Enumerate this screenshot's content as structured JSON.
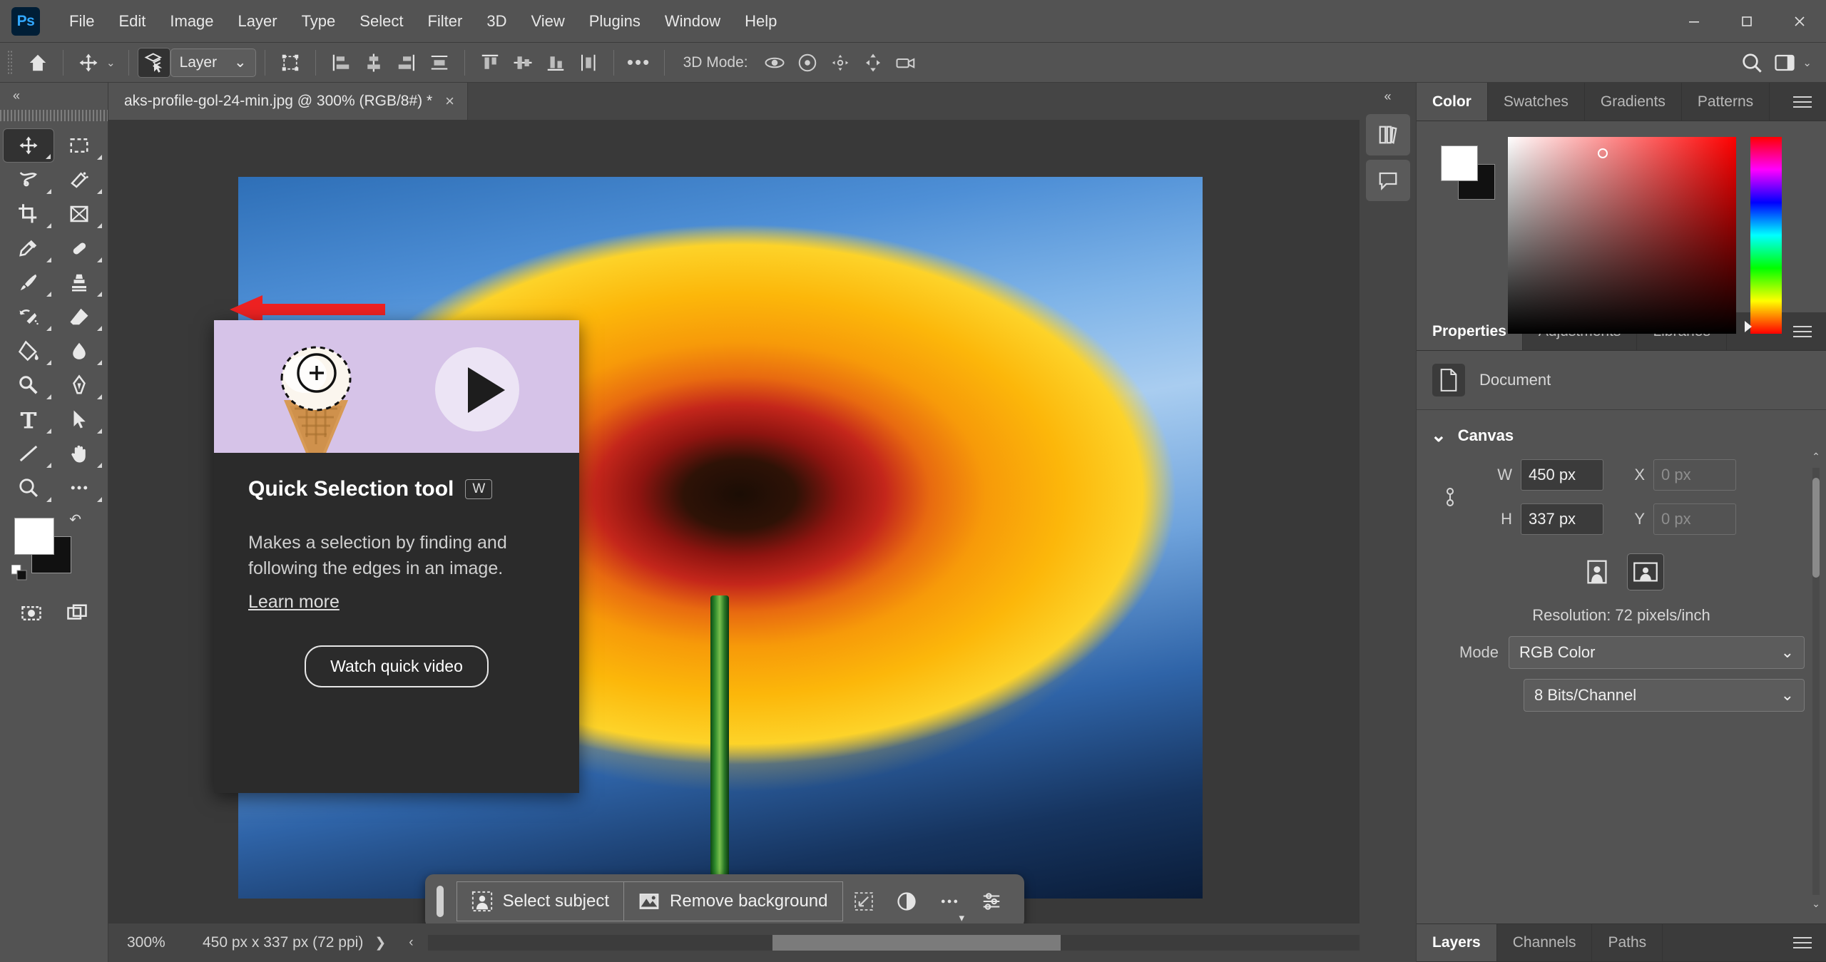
{
  "app": {
    "logo": "Ps",
    "accent": "#31a8ff",
    "chrome_bg": "#535353"
  },
  "menubar": {
    "items": [
      "File",
      "Edit",
      "Image",
      "Layer",
      "Type",
      "Select",
      "Filter",
      "3D",
      "View",
      "Plugins",
      "Window",
      "Help"
    ],
    "window_controls": {
      "minimize": "—",
      "maximize": "☐",
      "close": "✕"
    }
  },
  "optionsbar": {
    "home_icon": "home-icon",
    "move_tool_icon": "move-tool-icon",
    "auto_select_icon": "auto-select-layers-icon",
    "layer_select_value": "Layer",
    "transform_controls_icon": "show-transform-controls-icon",
    "align_icons": [
      "align-left-edges",
      "align-horizontal-centers",
      "align-right-edges",
      "distribute-horizontally"
    ],
    "distribute_icons": [
      "align-top-edges",
      "align-vertical-centers",
      "align-bottom-edges",
      "distribute-vertically"
    ],
    "more_label": "•••",
    "three_d_mode_label": "3D Mode:",
    "three_d_icons": [
      "orbit-3d-icon",
      "roll-3d-icon",
      "pan-3d-icon",
      "slide-3d-icon",
      "camera-3d-icon"
    ],
    "search_icon": "search-icon",
    "workspace_icon": "workspace-switcher-icon",
    "workspace_caret": "⌄"
  },
  "tools": {
    "collapse_label": "«",
    "items": [
      {
        "name": "move-tool",
        "glyph": "move",
        "active": true
      },
      {
        "name": "rectangular-marquee-tool",
        "glyph": "marquee",
        "active": false
      },
      {
        "name": "lasso-tool",
        "glyph": "lasso",
        "active": false
      },
      {
        "name": "quick-selection-tool",
        "glyph": "quickselect",
        "active": false
      },
      {
        "name": "crop-tool",
        "glyph": "crop",
        "active": false
      },
      {
        "name": "frame-tool",
        "glyph": "frame",
        "active": false
      },
      {
        "name": "eyedropper-tool",
        "glyph": "eyedropper",
        "active": false
      },
      {
        "name": "spot-healing-brush-tool",
        "glyph": "healing",
        "active": false
      },
      {
        "name": "brush-tool",
        "glyph": "brush",
        "active": false
      },
      {
        "name": "clone-stamp-tool",
        "glyph": "stamp",
        "active": false
      },
      {
        "name": "history-brush-tool",
        "glyph": "historybrush",
        "active": false
      },
      {
        "name": "eraser-tool",
        "glyph": "eraser",
        "active": false
      },
      {
        "name": "gradient-tool",
        "glyph": "bucket",
        "active": false
      },
      {
        "name": "blur-tool",
        "glyph": "blur",
        "active": false
      },
      {
        "name": "dodge-tool",
        "glyph": "dodge",
        "active": false
      },
      {
        "name": "pen-tool",
        "glyph": "pen",
        "active": false
      },
      {
        "name": "type-tool",
        "glyph": "type",
        "active": false
      },
      {
        "name": "path-selection-tool",
        "glyph": "pathselect",
        "active": false
      },
      {
        "name": "line-tool",
        "glyph": "line",
        "active": false
      },
      {
        "name": "hand-tool",
        "glyph": "hand",
        "active": false
      },
      {
        "name": "zoom-tool",
        "glyph": "zoom",
        "active": false
      },
      {
        "name": "edit-toolbar",
        "glyph": "ellipsis",
        "active": false
      }
    ],
    "foreground_color": "#ffffff",
    "background_color": "#111111",
    "quickmask_name": "quick-mask-icon",
    "screenmode_name": "screen-mode-icon"
  },
  "document": {
    "tab_title": "aks-profile-gol-24-min.jpg @ 300% (RGB/8#) *",
    "close_glyph": "×"
  },
  "tooltip": {
    "title": "Quick Selection tool",
    "shortcut": "W",
    "description": "Makes a selection by finding and following the edges in an image.",
    "link": "Learn more",
    "cta": "Watch quick video",
    "play_icon": "play-icon",
    "media_alt": "ice-cream-cone-selection-preview"
  },
  "annotation": {
    "arrow_color": "#ee2222",
    "arrow_name": "red-pointer-arrow"
  },
  "contextual_taskbar": {
    "grip_name": "drag-handle",
    "buttons": [
      {
        "label": "Select subject",
        "icon": "select-subject-icon"
      },
      {
        "label": "Remove background",
        "icon": "remove-background-icon"
      }
    ],
    "icon_buttons": [
      "transform-selection-icon",
      "adjustment-layer-icon",
      "more-options-icon",
      "taskbar-properties-icon"
    ],
    "caret": "▾"
  },
  "statusbar": {
    "zoom": "300%",
    "info": "450 px x 337 px (72 ppi)",
    "chevron_right": "❯",
    "chevron_left": "‹",
    "chevron_end": "›"
  },
  "iconrail": {
    "collapse": "«",
    "buttons": [
      "libraries-icon",
      "comments-icon"
    ]
  },
  "color_panel": {
    "tabs": [
      "Color",
      "Swatches",
      "Gradients",
      "Patterns"
    ],
    "active_tab": "Color",
    "menu_icon": "panel-menu-icon",
    "foreground": "#ffffff",
    "background": "#111111",
    "field_name": "color-field",
    "hue_strip_name": "hue-strip"
  },
  "properties_panel": {
    "tabs": [
      "Properties",
      "Adjustments",
      "Libraries"
    ],
    "active_tab": "Properties",
    "menu_icon": "panel-menu-icon",
    "doc_icon": "document-icon",
    "doc_label": "Document",
    "section": {
      "title": "Canvas",
      "collapse_caret": "⌄",
      "w_label": "W",
      "w_value": "450 px",
      "h_label": "H",
      "h_value": "337 px",
      "x_label": "X",
      "x_value": "0 px",
      "y_label": "Y",
      "y_value": "0 px",
      "link_icon": "link-dimensions-icon",
      "orientation": [
        "portrait-orientation-icon",
        "landscape-orientation-icon"
      ],
      "orientation_active": "landscape-orientation-icon",
      "resolution": "Resolution: 72 pixels/inch",
      "mode_label": "Mode",
      "mode_value": "RGB Color",
      "depth_value": "8 Bits/Channel"
    },
    "scroll_up": "⌃",
    "scroll_down": "⌄"
  },
  "layers_panel": {
    "tabs": [
      "Layers",
      "Channels",
      "Paths"
    ],
    "active_tab": "Layers",
    "menu_icon": "panel-menu-icon"
  }
}
